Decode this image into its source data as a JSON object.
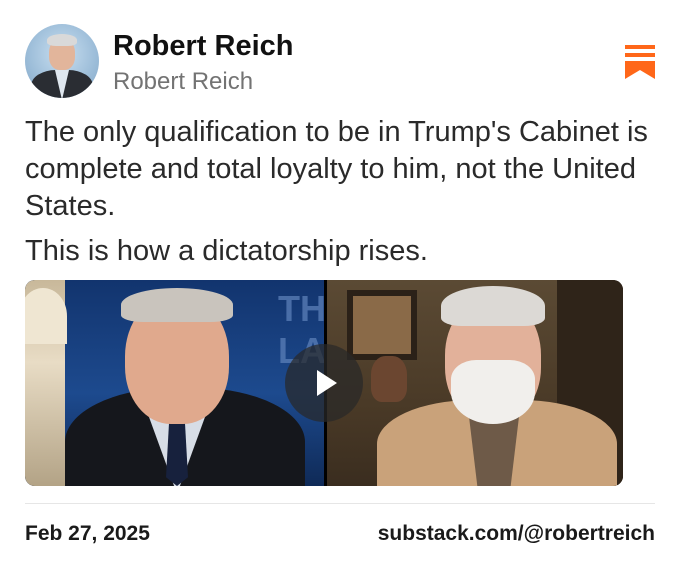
{
  "author": {
    "name": "Robert Reich",
    "handle": "Robert Reich",
    "avatar_icon": "author-avatar"
  },
  "brand": {
    "icon": "substack-logo-icon",
    "accent_color": "#ff6719"
  },
  "post": {
    "paragraphs": [
      "The only qualification to be in Trump's Cabinet is complete and total loyalty to him, not the United States.",
      "This is how a dictatorship rises."
    ]
  },
  "video": {
    "background_text": "THE LA",
    "play_icon": "play-icon"
  },
  "footer": {
    "date": "Feb 27, 2025",
    "profile_url": "substack.com/@robertreich"
  }
}
